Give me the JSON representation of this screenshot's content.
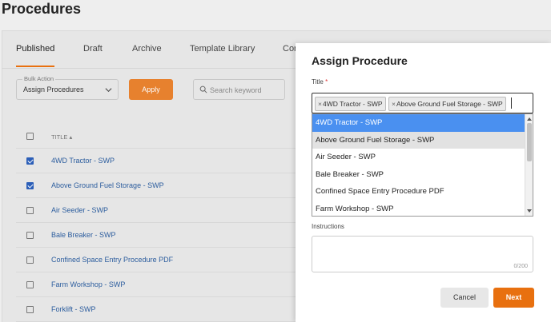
{
  "page": {
    "title": "Procedures"
  },
  "tabs": [
    "Published",
    "Draft",
    "Archive",
    "Template Library",
    "Cor"
  ],
  "toolbar": {
    "bulk_label": "Bulk Action",
    "bulk_value": "Assign Procedures",
    "apply_label": "Apply",
    "search_placeholder": "Search keyword"
  },
  "table": {
    "header": "TITLE",
    "rows": [
      {
        "title": "4WD Tractor - SWP",
        "checked": true
      },
      {
        "title": "Above Ground Fuel Storage - SWP",
        "checked": true
      },
      {
        "title": "Air Seeder - SWP",
        "checked": false
      },
      {
        "title": "Bale Breaker - SWP",
        "checked": false
      },
      {
        "title": "Confined Space Entry Procedure PDF",
        "checked": false
      },
      {
        "title": "Farm Workshop - SWP",
        "checked": false
      },
      {
        "title": "Forklift - SWP",
        "checked": false
      }
    ]
  },
  "modal": {
    "title": "Assign Procedure",
    "title_field_label": "Title",
    "required_mark": "*",
    "chips": [
      "4WD Tractor - SWP",
      "Above Ground Fuel Storage - SWP"
    ],
    "chip_remove": "×",
    "options": [
      {
        "label": "4WD Tractor - SWP",
        "state": "highlight"
      },
      {
        "label": "Above Ground Fuel Storage - SWP",
        "state": "selected"
      },
      {
        "label": "Air Seeder - SWP",
        "state": ""
      },
      {
        "label": "Bale Breaker - SWP",
        "state": ""
      },
      {
        "label": "Confined Space Entry Procedure PDF",
        "state": ""
      },
      {
        "label": "Farm Workshop - SWP",
        "state": ""
      }
    ],
    "instructions_label": "Instructions",
    "instructions_counter": "0/200",
    "cancel_label": "Cancel",
    "next_label": "Next"
  },
  "colors": {
    "accent": "#e8700f",
    "highlight": "#4a90f0",
    "link": "#2c5d9e",
    "checkbox": "#2c5fb8"
  }
}
